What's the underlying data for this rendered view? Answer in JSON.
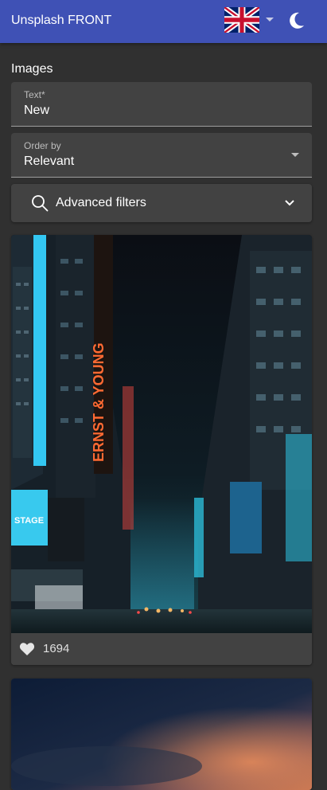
{
  "appbar": {
    "title": "Unsplash FRONT",
    "language_icon": "uk-flag-icon",
    "theme_icon": "moon-icon",
    "color": "#3f51b5"
  },
  "page": {
    "section_title": "Images"
  },
  "search": {
    "text_label": "Text*",
    "text_value": "New",
    "order_label": "Order by",
    "order_value": "Relevant"
  },
  "filters": {
    "label": "Advanced filters",
    "icon": "search-icon",
    "expand_icon": "chevron-down-icon"
  },
  "results": [
    {
      "image": "neon-city-street-night-photo",
      "sign_text": "ERNST & YOUNG",
      "billboard_text": "STAGE",
      "likes": "1694"
    },
    {
      "image": "dusk-sky-photo"
    }
  ]
}
